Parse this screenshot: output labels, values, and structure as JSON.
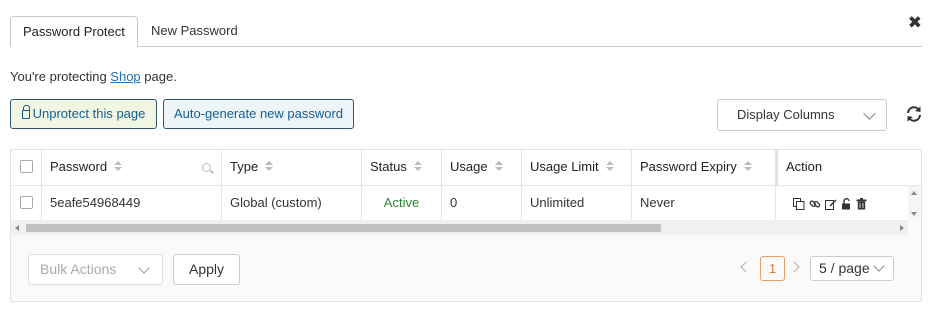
{
  "tabs": [
    {
      "label": "Password Protect",
      "active": true
    },
    {
      "label": "New Password",
      "active": false
    }
  ],
  "close_icon": "close-icon",
  "protect_line": {
    "prefix": "You're protecting ",
    "link": "Shop",
    "suffix": " page."
  },
  "buttons": {
    "unprotect": "Unprotect this page",
    "autogen": "Auto-generate new password",
    "display_columns": "Display Columns"
  },
  "table": {
    "headers": [
      "Password",
      "Type",
      "Status",
      "Usage",
      "Usage Limit",
      "Password Expiry",
      "Action"
    ],
    "rows": [
      {
        "password": "5eafe54968449",
        "type": "Global (custom)",
        "status": "Active",
        "usage": "0",
        "usage_limit": "Unlimited",
        "expiry": "Never",
        "actions": [
          "copy-icon",
          "link-icon",
          "edit-icon",
          "unlock-icon",
          "trash-icon"
        ]
      }
    ]
  },
  "footer": {
    "bulk_actions_placeholder": "Bulk Actions",
    "apply": "Apply",
    "current_page": "1",
    "per_page": "5 / page"
  },
  "colors": {
    "accent": "#135e96",
    "active_status": "#2e8b2e",
    "pagination_accent": "#e07b39",
    "unprotect_bg": "#f0f6e2"
  }
}
